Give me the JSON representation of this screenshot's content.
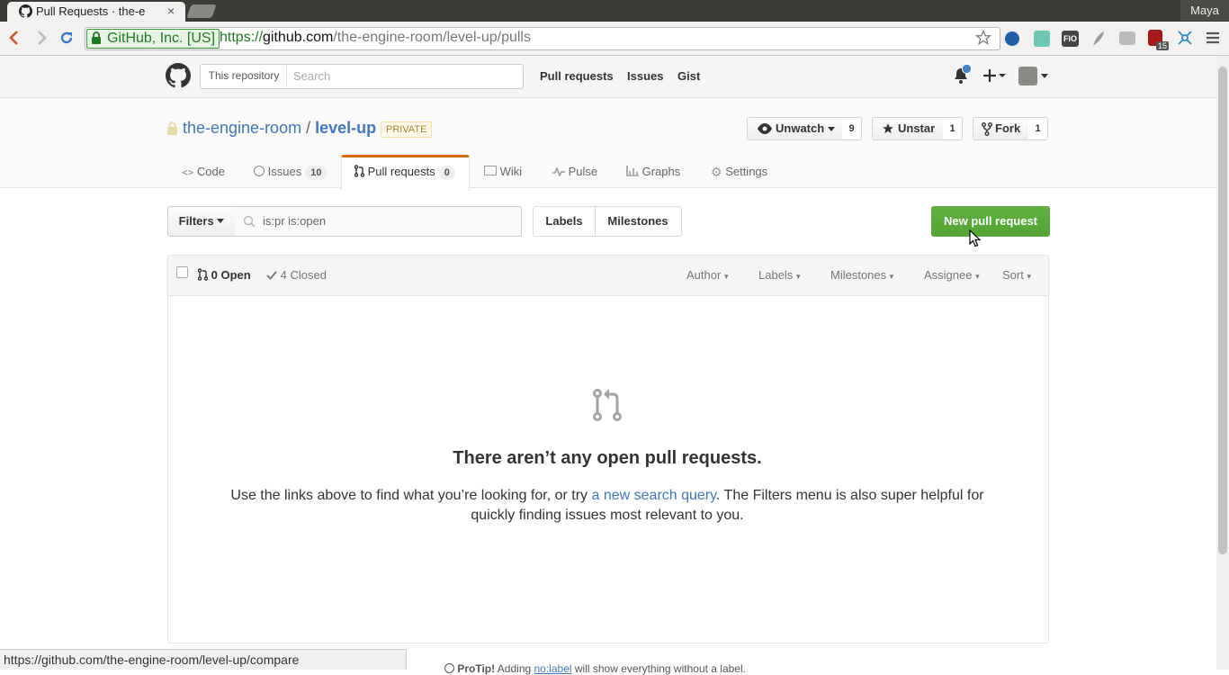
{
  "browser": {
    "tab_title": "Pull Requests · the-e",
    "tab_close": "×",
    "user": "Maya",
    "ev_label": "GitHub, Inc. [US]",
    "url_scheme": "https://",
    "url_host": "github.com",
    "url_path": "/the-engine-room/level-up/pulls",
    "ext_badge": "15",
    "ext_fio": "FIO",
    "status_url": "https://github.com/the-engine-room/level-up/compare"
  },
  "header": {
    "scope": "This repository",
    "search_placeholder": "Search",
    "nav": [
      "Pull requests",
      "Issues",
      "Gist"
    ]
  },
  "repo": {
    "owner": "the-engine-room",
    "sep": "/",
    "name": "level-up",
    "private_label": "PRIVATE",
    "watch_label": "Unwatch",
    "watch_count": "9",
    "star_label": "Unstar",
    "star_count": "1",
    "fork_label": "Fork",
    "fork_count": "1"
  },
  "tabs": [
    {
      "label": "Code"
    },
    {
      "label": "Issues",
      "count": "10"
    },
    {
      "label": "Pull requests",
      "count": "0"
    },
    {
      "label": "Wiki"
    },
    {
      "label": "Pulse"
    },
    {
      "label": "Graphs"
    },
    {
      "label": "Settings"
    }
  ],
  "subnav": {
    "filters_label": "Filters",
    "filter_value": "is:pr is:open",
    "labels_label": "Labels",
    "milestones_label": "Milestones",
    "new_pr_label": "New pull request"
  },
  "table": {
    "open_label": "0 Open",
    "closed_label": "4 Closed",
    "filters": [
      "Author",
      "Labels",
      "Milestones",
      "Assignee",
      "Sort"
    ]
  },
  "blank": {
    "title": "There aren’t any open pull requests.",
    "desc_before": "Use the links above to find what you’re looking for, or try ",
    "desc_link": "a new search query",
    "desc_after": ". The Filters menu is also super helpful for quickly finding issues most relevant to you."
  },
  "protip": {
    "lead": "ProTip!",
    "text_before": " Adding ",
    "link": "no:label",
    "text_after": " will show everything without a label."
  },
  "colors": {
    "accent": "#4078c0",
    "green": "#55a532",
    "tab_accent": "#d26911"
  }
}
